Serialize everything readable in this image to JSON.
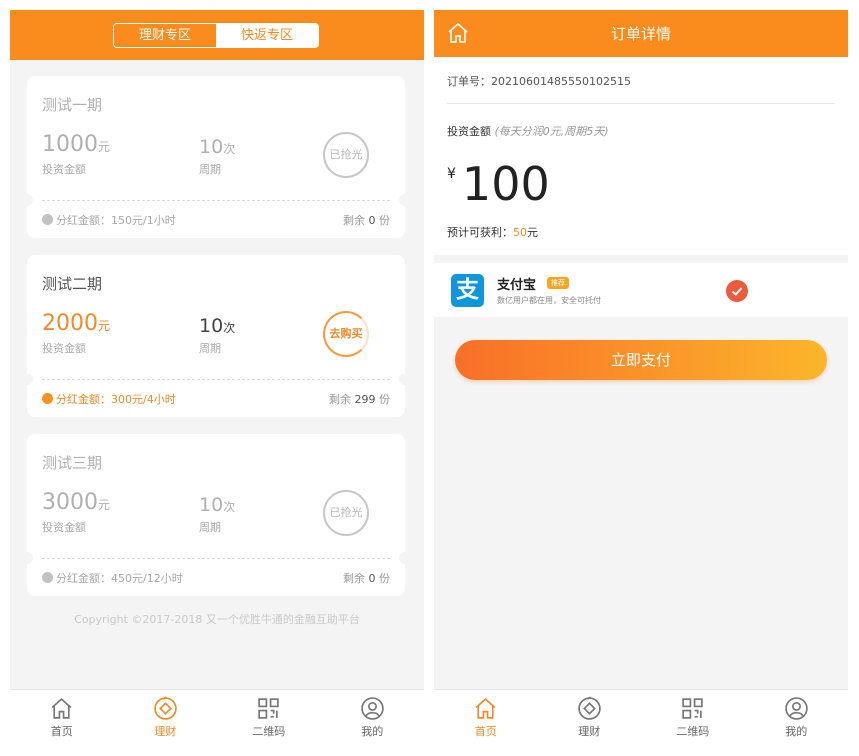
{
  "left": {
    "tabs": [
      "理财专区",
      "快返专区"
    ],
    "products": [
      {
        "title": "测试一期",
        "amount": "1000",
        "amount_unit": "元",
        "amount_label": "投资金额",
        "cycle": "10",
        "cycle_unit": "次",
        "cycle_label": "周期",
        "status": "已抢光",
        "dividend_label": "分红金额：",
        "dividend": "150元/1小时",
        "remain_label": "剩余",
        "remain": "0",
        "remain_unit": "份"
      },
      {
        "title": "测试二期",
        "amount": "2000",
        "amount_unit": "元",
        "amount_label": "投资金额",
        "cycle": "10",
        "cycle_unit": "次",
        "cycle_label": "周期",
        "status": "去购买",
        "dividend_label": "分红金额：",
        "dividend": "300元/4小时",
        "remain_label": "剩余",
        "remain": "299",
        "remain_unit": "份"
      },
      {
        "title": "测试三期",
        "amount": "3000",
        "amount_unit": "元",
        "amount_label": "投资金额",
        "cycle": "10",
        "cycle_unit": "次",
        "cycle_label": "周期",
        "status": "已抢光",
        "dividend_label": "分红金额：",
        "dividend": "450元/12小时",
        "remain_label": "剩余",
        "remain": "0",
        "remain_unit": "份"
      }
    ],
    "copyright": "Copyright ©2017-2018 又一个优胜牛通的金融互助平台"
  },
  "nav": {
    "home": "首页",
    "finance": "理财",
    "qrcode": "二维码",
    "mine": "我的"
  },
  "right": {
    "title": "订单详情",
    "order_no_label": "订单号：",
    "order_no": "20210601485550102515",
    "invest_label": "投资金额",
    "invest_hint": "(每天分润0元,周期5天)",
    "currency": "¥",
    "amount": "100",
    "profit_label": "预计可获利：",
    "profit_value": "50",
    "profit_unit": "元",
    "payment": {
      "name": "支付宝",
      "tag": "推荐",
      "sub": "数亿用户都在用，安全可托付",
      "logo_char": "支"
    },
    "pay_button": "立即支付"
  },
  "colors": {
    "brand": "#fa8c1d",
    "accent": "#f08a2a",
    "check": "#eb5a3c",
    "alipay": "#1296db"
  }
}
